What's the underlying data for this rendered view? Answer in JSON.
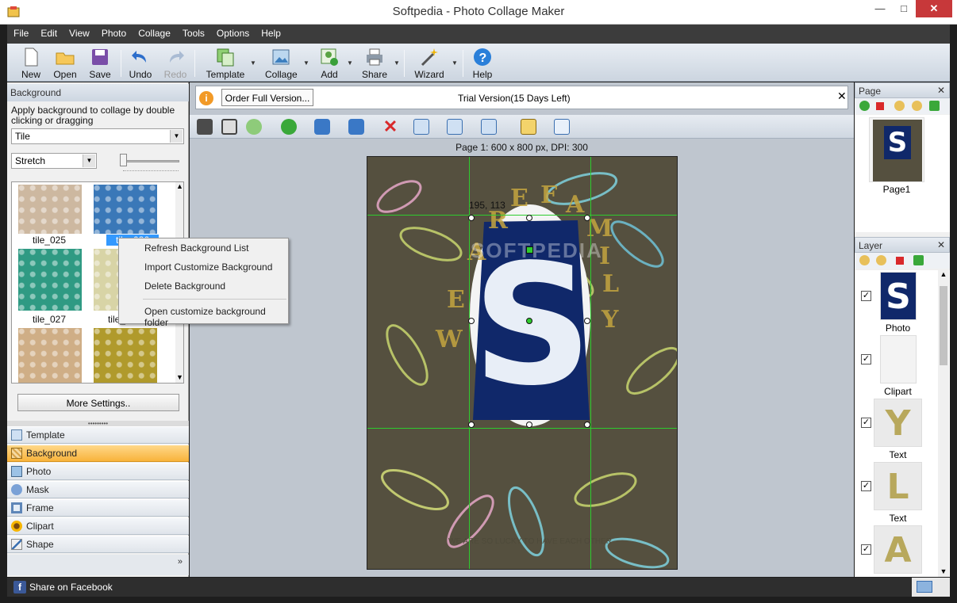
{
  "window": {
    "title": "Softpedia - Photo Collage Maker",
    "minimize": "—",
    "maximize": "□",
    "close": "✕"
  },
  "menu": [
    "File",
    "Edit",
    "View",
    "Photo",
    "Collage",
    "Tools",
    "Options",
    "Help"
  ],
  "toolbar": {
    "new": "New",
    "open": "Open",
    "save": "Save",
    "undo": "Undo",
    "redo": "Redo",
    "template": "Template",
    "collage": "Collage",
    "add": "Add",
    "share": "Share",
    "wizard": "Wizard",
    "help": "Help"
  },
  "left": {
    "header": "Background",
    "desc": "Apply background to collage by double clicking or dragging",
    "mode_combo": "Tile",
    "fit_combo": "Stretch",
    "thumbs": [
      {
        "label": "tile_025",
        "color": "#cdb8a0"
      },
      {
        "label": "tile_026",
        "color": "#3a78b8"
      },
      {
        "label": "tile_027",
        "color": "#2f9a83"
      },
      {
        "label": "tile_028",
        "color": "#d8d4a6"
      },
      {
        "label": "",
        "color": "#cfae86"
      },
      {
        "label": "",
        "color": "#b09a2c"
      }
    ],
    "more_settings": "More Settings..",
    "nav": [
      "Template",
      "Background",
      "Photo",
      "Mask",
      "Frame",
      "Clipart",
      "Shape"
    ],
    "nav_more": "»"
  },
  "context_menu": [
    "Refresh Background List",
    "Import Customize Background",
    "Delete Background",
    "Open customize background folder"
  ],
  "center": {
    "order_button": "Order Full Version...",
    "trial_text": "Trial Version(15 Days Left)",
    "trial_close": "✕",
    "page_info": "Page 1: 600 x 800 px, DPI: 300",
    "coords": "195, 113",
    "canvas_text_arc": "WE ARE FAMILY",
    "canvas_caption": "WE ARE SO LUCKY TO HAVE EACH OTHER",
    "watermark": "SOFTPEDIA"
  },
  "right": {
    "page_header": "Page",
    "page_label": "Page1",
    "layer_header": "Layer",
    "layers": [
      {
        "name": "Photo",
        "glyph": "S"
      },
      {
        "name": "Clipart",
        "glyph": ""
      },
      {
        "name": "Text",
        "glyph": "Y"
      },
      {
        "name": "Text",
        "glyph": "L"
      },
      {
        "name": "",
        "glyph": "A"
      }
    ]
  },
  "status": {
    "share_facebook": "Share on Facebook"
  },
  "colors": {
    "accent": "#f8b33b",
    "menubar": "#3c3c3c",
    "canvas_bg": "#55503f",
    "guide": "#2ecc2e",
    "photo_blue": "#10286a"
  }
}
